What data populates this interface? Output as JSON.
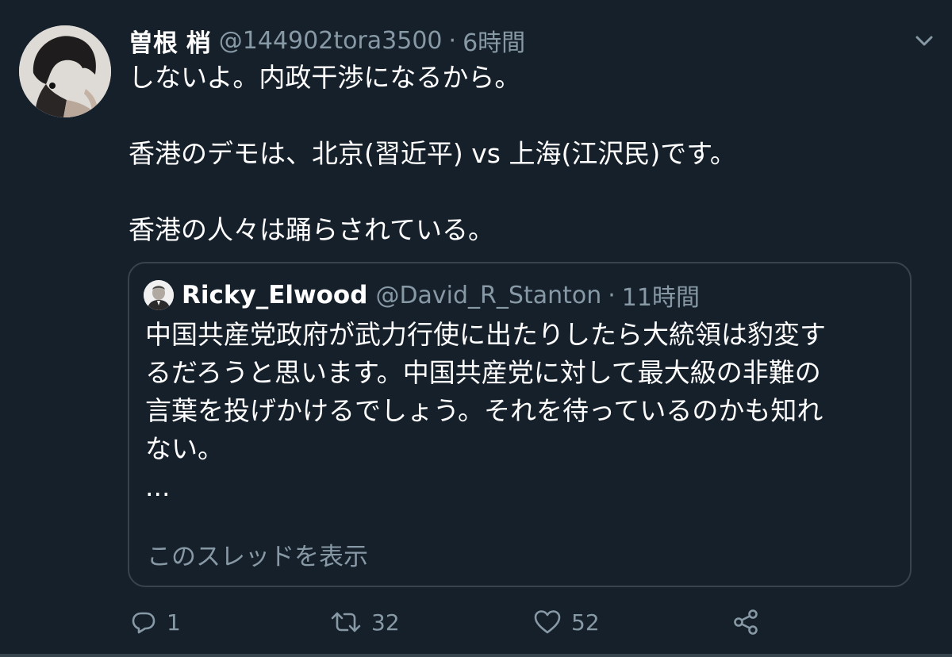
{
  "tweet": {
    "author_name": "曽根 梢",
    "author_handle": "@144902tora3500",
    "separator": "·",
    "time": "6時間",
    "lines": [
      "しないよ。内政干渉になるから。",
      "香港のデモは、北京(習近平) vs 上海(江沢民)です。",
      "香港の人々は踊らされている。"
    ]
  },
  "quote": {
    "author_name": "Ricky_Elwood",
    "author_handle": "@David_R_Stanton",
    "separator": "·",
    "time": "11時間",
    "lines": [
      "中国共産党政府が武力行使に出たりしたら大統領は豹変す",
      "るだろうと思います。中国共産党に対して最大級の非難の",
      "言葉を投げかけるでしょう。それを待っているのかも知れ",
      "ない。",
      "..."
    ],
    "show_thread": "このスレッドを表示"
  },
  "actions": {
    "reply_icon": "reply-icon",
    "reply_count": "1",
    "retweet_icon": "retweet-icon",
    "retweet_count": "32",
    "like_icon": "heart-icon",
    "like_count": "52",
    "share_icon": "share-icon"
  },
  "colors": {
    "background": "#15202b",
    "text": "#ffffff",
    "secondary": "#8899a6",
    "border": "#38444d"
  }
}
